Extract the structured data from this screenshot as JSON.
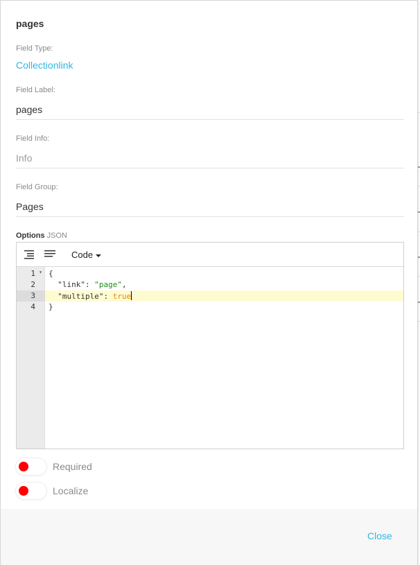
{
  "modal": {
    "title": "pages",
    "field_type": {
      "label": "Field Type:",
      "value": "Collectionlink"
    },
    "field_label": {
      "label": "Field Label:",
      "value": "pages"
    },
    "field_info": {
      "label": "Field Info:",
      "value": "",
      "placeholder": "Info"
    },
    "field_group": {
      "label": "Field Group:",
      "value": "Pages"
    },
    "options": {
      "label": "Options",
      "label_suffix": "JSON",
      "editor": {
        "mode_label": "Code",
        "line_numbers": [
          "1",
          "2",
          "3",
          "4"
        ],
        "active_line": "3",
        "lines": {
          "l1": "{",
          "l2_key": "  \"link\"",
          "l2_sep": ": ",
          "l2_val": "\"page\"",
          "l2_end": ",",
          "l3_key": "  \"multiple\"",
          "l3_sep": ": ",
          "l3_val": "true",
          "l4": "}"
        }
      }
    },
    "toggles": [
      {
        "label": "Required",
        "on": false
      },
      {
        "label": "Localize",
        "on": false
      }
    ],
    "close_label": "Close"
  },
  "colors": {
    "accent": "#30b7e0",
    "toggle_knob": "#ff0000",
    "string_token": "#1a8f1a",
    "boolean_token": "#e68a00",
    "active_line_bg": "#fffbd1"
  },
  "icons": {
    "format": "format-json-icon",
    "compact": "compact-json-icon",
    "dropdown": "chevron-down-icon",
    "fold": "fold-arrow-icon"
  }
}
